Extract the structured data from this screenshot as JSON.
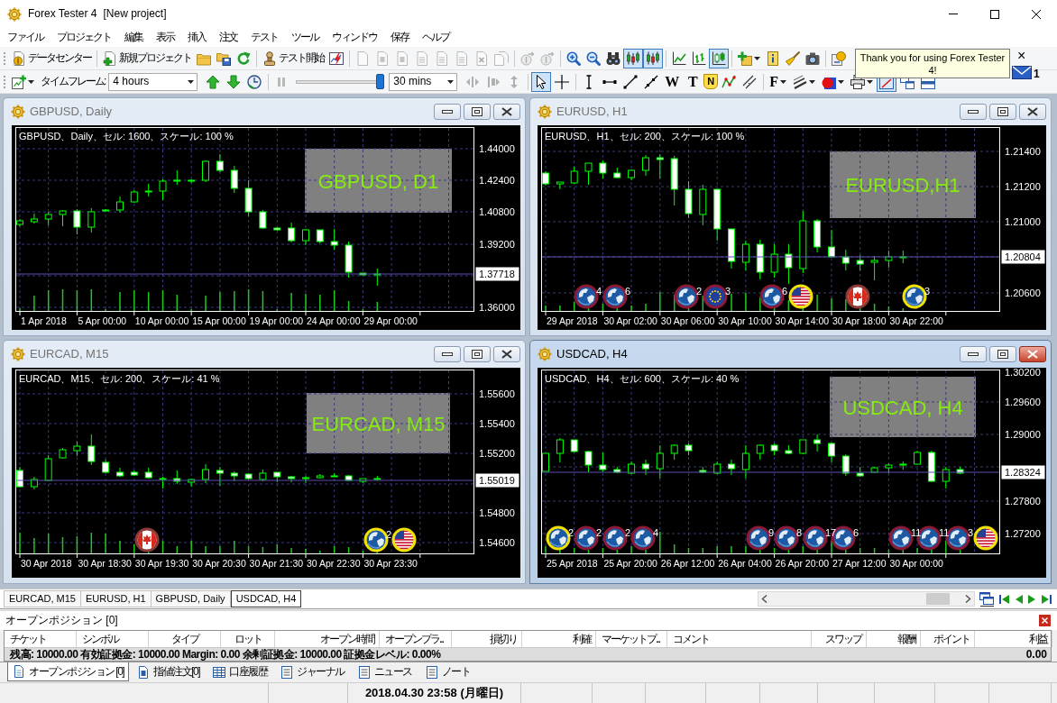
{
  "window": {
    "title": "Forex Tester 4",
    "project": "[New project]"
  },
  "menu": [
    "ファイル",
    "プロジェクト",
    "編集",
    "表示",
    "挿入",
    "注文",
    "テスト",
    "ツール",
    "ウィンドウ",
    "保存",
    "ヘルプ"
  ],
  "toolbar_1": [
    {
      "label": "データセンター",
      "selected": false,
      "disabled": false
    },
    {
      "label": "新規プロジェクト",
      "selected": false,
      "disabled": false
    },
    {
      "selected": false,
      "disabled": false
    },
    {
      "selected": false,
      "disabled": false
    },
    {
      "selected": false,
      "disabled": false
    },
    {
      "label": "テスト開始",
      "selected": false,
      "disabled": false
    },
    {
      "selected": false,
      "disabled": false
    },
    {
      "selected": false,
      "disabled": true
    },
    {
      "selected": false,
      "disabled": true
    },
    {
      "selected": false,
      "disabled": true
    },
    {
      "selected": false,
      "disabled": true
    },
    {
      "selected": false,
      "disabled": true
    },
    {
      "selected": false,
      "disabled": true
    },
    {
      "selected": false,
      "disabled": true
    },
    {
      "selected": false,
      "disabled": true
    },
    {
      "selected": false,
      "disabled": true
    },
    {
      "selected": false,
      "disabled": true
    },
    {
      "selected": false,
      "disabled": false
    },
    {
      "selected": false,
      "disabled": false
    },
    {
      "selected": false,
      "disabled": false
    },
    {
      "selected": true,
      "disabled": false
    },
    {
      "selected": true,
      "disabled": false
    },
    {
      "selected": false,
      "disabled": false
    },
    {
      "selected": false,
      "disabled": false
    },
    {
      "selected": true,
      "disabled": false
    },
    {
      "selected": false,
      "disabled": false
    },
    {
      "selected": false,
      "disabled": false
    },
    {
      "selected": false,
      "disabled": false
    },
    {
      "selected": false,
      "disabled": false
    },
    {
      "selected": false,
      "disabled": false
    }
  ],
  "toolbar_2": [
    {
      "kind": "button",
      "selected": false,
      "disabled": false
    },
    {
      "kind": "text",
      "label": "タイムフレーム:"
    },
    {
      "kind": "select",
      "value": "4 hours"
    },
    {
      "kind": "button",
      "selected": false,
      "disabled": false
    },
    {
      "kind": "button",
      "selected": false,
      "disabled": false
    },
    {
      "kind": "button",
      "selected": false,
      "disabled": false
    },
    {
      "kind": "button",
      "selected": false,
      "disabled": true
    },
    {
      "kind": "slider",
      "level": 1
    },
    {
      "kind": "select",
      "value": "30 mins"
    },
    {
      "kind": "button",
      "selected": false,
      "disabled": true
    },
    {
      "kind": "button",
      "selected": false,
      "disabled": true
    },
    {
      "kind": "button",
      "selected": false,
      "disabled": true
    },
    {
      "kind": "button",
      "selected": true,
      "disabled": false
    },
    {
      "kind": "button",
      "selected": false,
      "disabled": false
    },
    {
      "kind": "button",
      "selected": false,
      "disabled": false
    },
    {
      "kind": "button",
      "selected": false,
      "disabled": false
    },
    {
      "kind": "button",
      "selected": false,
      "disabled": false
    },
    {
      "kind": "button",
      "selected": false,
      "disabled": false
    },
    {
      "kind": "button",
      "label": "W",
      "selected": false,
      "disabled": false
    },
    {
      "kind": "button",
      "label": "T",
      "selected": false,
      "disabled": false
    },
    {
      "kind": "button",
      "label": "N",
      "selected": false,
      "disabled": false
    },
    {
      "kind": "button",
      "selected": false,
      "disabled": false
    },
    {
      "kind": "button",
      "selected": false,
      "disabled": false
    },
    {
      "kind": "button",
      "label": "F",
      "selected": false,
      "disabled": false
    },
    {
      "kind": "button",
      "selected": false,
      "disabled": false
    },
    {
      "kind": "button",
      "selected": false,
      "disabled": false
    },
    {
      "kind": "button",
      "selected": false,
      "disabled": false
    },
    {
      "kind": "button",
      "selected": true,
      "disabled": false
    },
    {
      "kind": "button",
      "selected": false,
      "disabled": false
    },
    {
      "kind": "button",
      "selected": false,
      "disabled": false
    }
  ],
  "notice": {
    "text": "Thank you for using Forex Tester 4!",
    "close": "×",
    "mail_count": "1"
  },
  "charts": [
    {
      "title": "GBPUSD, Daily",
      "active": false,
      "info": "GBPUSD、Daily、セル: 1600、スケール: 100 %",
      "watermark": "GBPUSD, D1",
      "price_labels": [
        "1.44000",
        "1.42400",
        "1.40800",
        "1.39200",
        "1.36000"
      ],
      "current_price": "1.37718",
      "time_labels": [
        "1 Apr 2018",
        "5 Apr 00:00",
        "10 Apr 00:00",
        "15 Apr 00:00",
        "19 Apr 00:00",
        "24 Apr 00:00",
        "29 Apr 00:00"
      ]
    },
    {
      "title": "EURUSD, H1",
      "active": false,
      "info": "EURUSD、H1、セル: 200、スケール: 100 %",
      "watermark": "EURUSD,H1",
      "price_labels": [
        "1.21400",
        "1.21200",
        "1.21000",
        "1.20600"
      ],
      "current_price": "1.20804",
      "time_labels": [
        "29 Apr 2018",
        "30 Apr 02:00",
        "30 Apr 06:00",
        "30 Apr 10:00",
        "30 Apr 14:00",
        "30 Apr 18:00",
        "30 Apr 22:00"
      ],
      "events": [
        {
          "kind": "global",
          "color": "#8b1a35",
          "count": "4"
        },
        {
          "kind": "global",
          "color": "#8b1a35",
          "count": "6"
        },
        {
          "kind": "global",
          "color": "#8b1a35",
          "count": "2"
        },
        {
          "kind": "eur",
          "color": "#8b1a35",
          "count": "3"
        },
        {
          "kind": "global",
          "color": "#8b1a35",
          "count": "6"
        },
        {
          "kind": "usd",
          "color": "#f2e200"
        },
        {
          "kind": "cad",
          "color": "#8c3a36"
        },
        {
          "kind": "global",
          "color": "#f2e200",
          "count": "3"
        }
      ]
    },
    {
      "title": "EURCAD, M15",
      "active": false,
      "info": "EURCAD、M15、セル: 200、スケール: 41 %",
      "watermark": "EURCAD, M15",
      "price_labels": [
        "1.55600",
        "1.55400",
        "1.55200",
        "1.54800",
        "1.54600"
      ],
      "current_price": "1.55019",
      "time_labels": [
        "30 Apr 2018",
        "30 Apr 18:30",
        "30 Apr 19:30",
        "30 Apr 20:30",
        "30 Apr 21:30",
        "30 Apr 22:30",
        "30 Apr 23:30"
      ],
      "events": [
        {
          "kind": "cad",
          "color": "#8c3a36"
        },
        {
          "kind": "global",
          "color": "#f2e200",
          "count": "2"
        },
        {
          "kind": "usd",
          "color": "#f2e200"
        }
      ]
    },
    {
      "title": "USDCAD, H4",
      "active": true,
      "info": "USDCAD、H4、セル: 600、スケール: 40 %",
      "watermark": "USDCAD, H4",
      "price_labels": [
        "1.30200",
        "1.29600",
        "1.29000",
        "1.27800",
        "1.27200"
      ],
      "current_price": "1.28324",
      "time_labels": [
        "25 Apr 2018",
        "25 Apr 20:00",
        "26 Apr 12:00",
        "26 Apr 04:00",
        "26 Apr 20:00",
        "27 Apr 12:00",
        "30 Apr 00:00"
      ],
      "events": [
        {
          "kind": "global",
          "color": "#f2e200",
          "count": "2"
        },
        {
          "kind": "global",
          "color": "#8b1a35",
          "count": "2"
        },
        {
          "kind": "global",
          "color": "#8b1a35",
          "count": "2"
        },
        {
          "kind": "global",
          "color": "#8b1a35",
          "count": "4"
        },
        {
          "kind": "global",
          "color": "#8b1a35",
          "count": "9"
        },
        {
          "kind": "global",
          "color": "#8b1a35",
          "count": "8"
        },
        {
          "kind": "global",
          "color": "#8b1a35",
          "count": "17"
        },
        {
          "kind": "global",
          "color": "#8b1a35",
          "count": "6"
        },
        {
          "kind": "global",
          "color": "#8b1a35",
          "count": "11"
        },
        {
          "kind": "global",
          "color": "#8b1a35",
          "count": "11"
        },
        {
          "kind": "global",
          "color": "#8b1a35",
          "count": "3"
        },
        {
          "kind": "usd",
          "color": "#f2e200"
        }
      ]
    }
  ],
  "window_tabs": [
    {
      "label": "EURCAD, M15",
      "selected": false
    },
    {
      "label": "EURUSD, H1",
      "selected": false
    },
    {
      "label": "GBPUSD, Daily",
      "selected": false
    },
    {
      "label": "USDCAD, H4",
      "selected": true
    }
  ],
  "positions_panel": {
    "title": "オープンポジション [0]",
    "columns": [
      "チケット",
      "シンボル",
      "タイプ",
      "ロット",
      "オープン時間",
      "オープンプラ...",
      "損切り",
      "利確",
      "マーケットプ...",
      "コメント",
      "スワップ",
      "報酬",
      "ポイント",
      "利益"
    ],
    "summary": "残高: 10000.00 有効証拠金: 10000.00 Margin: 0.00 余剰証拠金: 10000.00 証拠金レベル: 0.00%",
    "summary_total": "0.00"
  },
  "panel_tabs": [
    {
      "label": "オープンポジション [0]",
      "selected": true
    },
    {
      "label": "指値注文[0]",
      "selected": false
    },
    {
      "label": "口座履歴",
      "selected": false
    },
    {
      "label": "ジャーナル",
      "selected": false
    },
    {
      "label": "ニュース",
      "selected": false
    },
    {
      "label": "ノート",
      "selected": false
    }
  ],
  "status_bar": {
    "datetime": "2018.04.30 23:58 (月曜日)"
  }
}
